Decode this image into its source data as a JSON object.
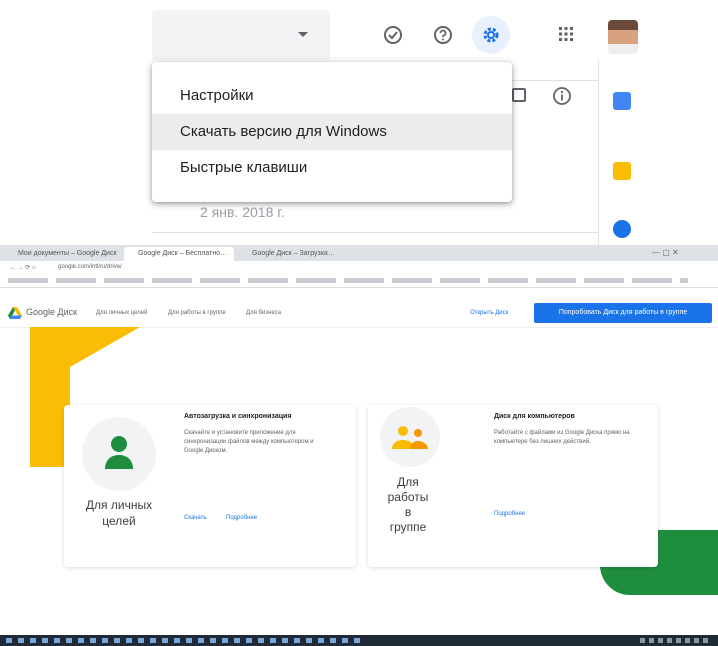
{
  "menu": {
    "items": [
      {
        "label": "Настройки"
      },
      {
        "label": "Скачать версию для Windows"
      },
      {
        "label": "Быстрые клавиши"
      }
    ]
  },
  "behind": {
    "date_text": "2 янв. 2018 г."
  },
  "browser": {
    "tabs": [
      "Мои документы – Google Диск",
      "Google Диск – Бесплатно…",
      "Google Диск – Загрузка…"
    ],
    "url": "google.com/intl/ru/drive/",
    "brand": "Google Диск",
    "nav": [
      "Для личных целей",
      "Для работы в группе",
      "Для бизнеса"
    ],
    "open_drive": "Открыть Диск",
    "cta": "Попробовать Диск для работы в группе",
    "personal": {
      "label_line1": "Для личных",
      "label_line2": "целей",
      "feature_title": "Автозагрузка и синхронизация",
      "feature_text": "Скачайте и установите приложение для синхронизации файлов между компьютером и Google Диском.",
      "link_download": "Скачать",
      "link_more": "Подробнее"
    },
    "team": {
      "label_line1": "Для",
      "label_line2": "работы",
      "label_line3": "в",
      "label_line4": "группе",
      "feature_title": "Диск для компьютеров",
      "feature_text": "Работайте с файлами из Google Диска прямо на компьютере без лишних действий.",
      "link_more": "Подробнее"
    }
  },
  "colors": {
    "accent": "#1a73e8",
    "green": "#1e8e3e",
    "yellow": "#fbbc04"
  }
}
